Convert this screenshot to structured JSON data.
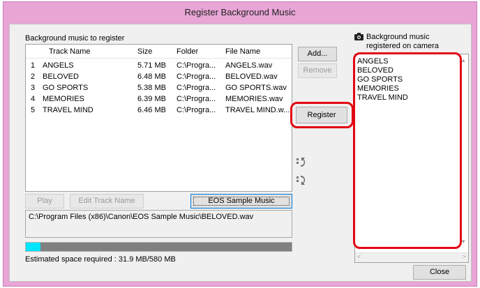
{
  "window": {
    "title": "Register Background Music"
  },
  "left_panel": {
    "label": "Background music to register",
    "columns": [
      "",
      "Track Name",
      "Size",
      "Folder",
      "File Name"
    ],
    "rows": [
      {
        "no": "1",
        "track": "ANGELS",
        "size": "5.71 MB",
        "folder": "C:\\Progra...",
        "file": "ANGELS.wav"
      },
      {
        "no": "2",
        "track": "BELOVED",
        "size": "6.48 MB",
        "folder": "C:\\Progra...",
        "file": "BELOVED.wav"
      },
      {
        "no": "3",
        "track": "GO SPORTS",
        "size": "5.38 MB",
        "folder": "C:\\Progra...",
        "file": "GO SPORTS.wav"
      },
      {
        "no": "4",
        "track": "MEMORIES",
        "size": "6.39 MB",
        "folder": "C:\\Progra...",
        "file": "MEMORIES.wav"
      },
      {
        "no": "5",
        "track": "TRAVEL MIND",
        "size": "6.46 MB",
        "folder": "C:\\Progra...",
        "file": "TRAVEL MIND.w..."
      }
    ],
    "play_label": "Play",
    "edit_label": "Edit Track Name",
    "sample_label": "EOS Sample Music",
    "selected_path": "C:\\Program Files (x86)\\Canon\\EOS Sample Music\\BELOVED.wav",
    "progress_fraction": 0.055,
    "space_label": "Estimated space required : 31.9 MB/580 MB"
  },
  "middle": {
    "add_label": "Add...",
    "remove_label": "Remove",
    "register_label": "Register"
  },
  "right_panel": {
    "label_line1": "Background music",
    "label_line2": "registered on camera",
    "items": [
      "ANGELS",
      "BELOVED",
      "GO SPORTS",
      "MEMORIES",
      "TRAVEL MIND"
    ],
    "close_label": "Close"
  },
  "colors": {
    "accent_highlight": "#e30613",
    "progress_fill": "#00e5ff",
    "title_bar": "#e8a5d6"
  }
}
